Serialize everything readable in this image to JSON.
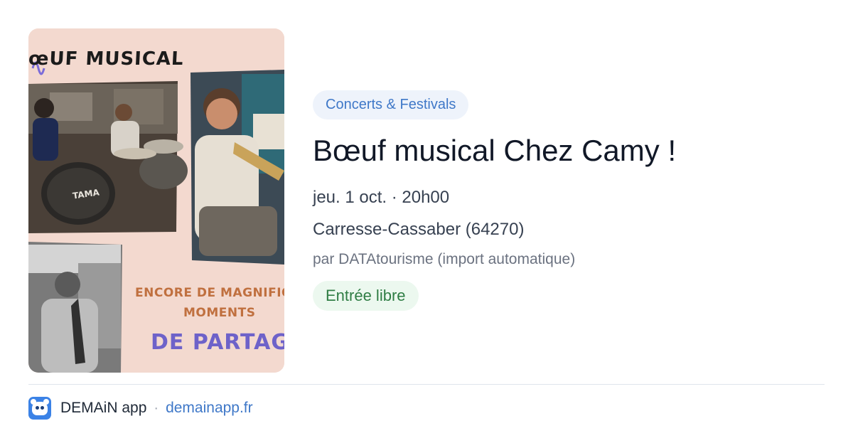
{
  "event": {
    "category": "Concerts & Festivals",
    "title": "Bœuf musical Chez Camy !",
    "datetime": "jeu. 1 oct. · 20h00",
    "place": "Carresse-Cassaber (64270)",
    "author": "par DATAtourisme (import automatique)",
    "price": "Entrée libre"
  },
  "poster": {
    "title_text": "œUF MUSICAL",
    "line1": "ENCORE DE MAGNIFIQ",
    "line2": "MOMENTS",
    "line3": "DE PARTAG",
    "drum_brand": "TAMA",
    "colors": {
      "background": "#f3d9cf",
      "title": "#1b1b1b",
      "orange_text": "#c0703f",
      "purple_text": "#6e62c9"
    }
  },
  "footer": {
    "app_name": "DEMAiN app",
    "separator": "·",
    "url": "demainapp.fr",
    "logo_icon": "demain-app-logo-icon"
  },
  "colors": {
    "accent_blue": "#3f78c8",
    "category_bg": "#eef3fb",
    "price_text": "#2f7d44",
    "price_bg": "#ecf8ef",
    "title": "#111827",
    "muted": "#6b7280"
  }
}
